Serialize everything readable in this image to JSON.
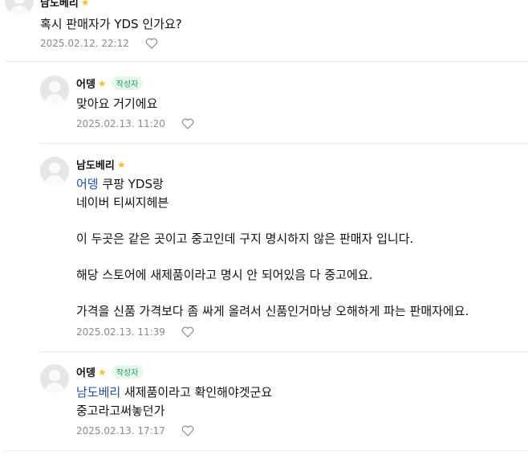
{
  "comments": [
    {
      "author": "남도베리",
      "lines": [
        "혹시 판매자가 YDS 인가요?"
      ],
      "date": "2025.02.12. 22:12"
    },
    {
      "author": "어뎅",
      "badge": "작성자",
      "lines": [
        "맞아요 거기에요"
      ],
      "date": "2025.02.13. 11:20"
    },
    {
      "author": "남도베리",
      "mention": "어뎅",
      "first_line_rest": "쿠팡 YDS랑",
      "lines": [
        "네이버 티씨지헤븐",
        "",
        "이 두곳은 같은 곳이고 중고인데 구지 명시하지 않은 판매자 입니다.",
        "",
        "해당 스토어에 새제품이라고 명시 안 되어있음 다 중고에요.",
        "",
        "가격을 신품 가격보다 좀 싸게 올려서 신품인거마냥 오해하게 파는 판매자에요."
      ],
      "date": "2025.02.13. 11:39"
    },
    {
      "author": "어뎅",
      "badge": "작성자",
      "mention": "남도베리",
      "first_line_rest": "새제품이라고 확인해야겟군요",
      "lines": [
        "중고라고써놓던가"
      ],
      "date": "2025.02.13. 17:17"
    }
  ],
  "icons": {
    "star": "star-icon",
    "like": "heart-outline-icon",
    "avatar": "default-avatar-icon"
  },
  "colors": {
    "mention": "#1f4fb3",
    "badge_text": "#1f9e5a",
    "badge_bg": "#e6f7ed",
    "star": "#f2c230",
    "meta": "#8a8a8a"
  }
}
